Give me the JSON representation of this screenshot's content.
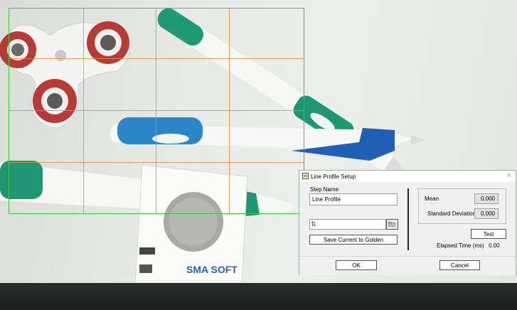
{
  "dialog": {
    "title": "Line Profile Setup",
    "close_glyph": "✕",
    "step_name_label": "Step Name",
    "step_name_value": "Line Profile",
    "path_value": "",
    "save_golden_label": "Save Current to Golden",
    "mean_label": "Mean",
    "mean_value": "0.000",
    "std_label": "Standard Deviation",
    "std_value": "0.000",
    "test_label": "Test",
    "elapsed_label": "Elapsed Time (ms)",
    "elapsed_value": "0.00",
    "ok_label": "OK",
    "cancel_label": "Cancel"
  },
  "camera": {
    "card_text": "SMA SOFT",
    "roi_color": "#3dc93d",
    "grid_color": "#e2903b"
  }
}
